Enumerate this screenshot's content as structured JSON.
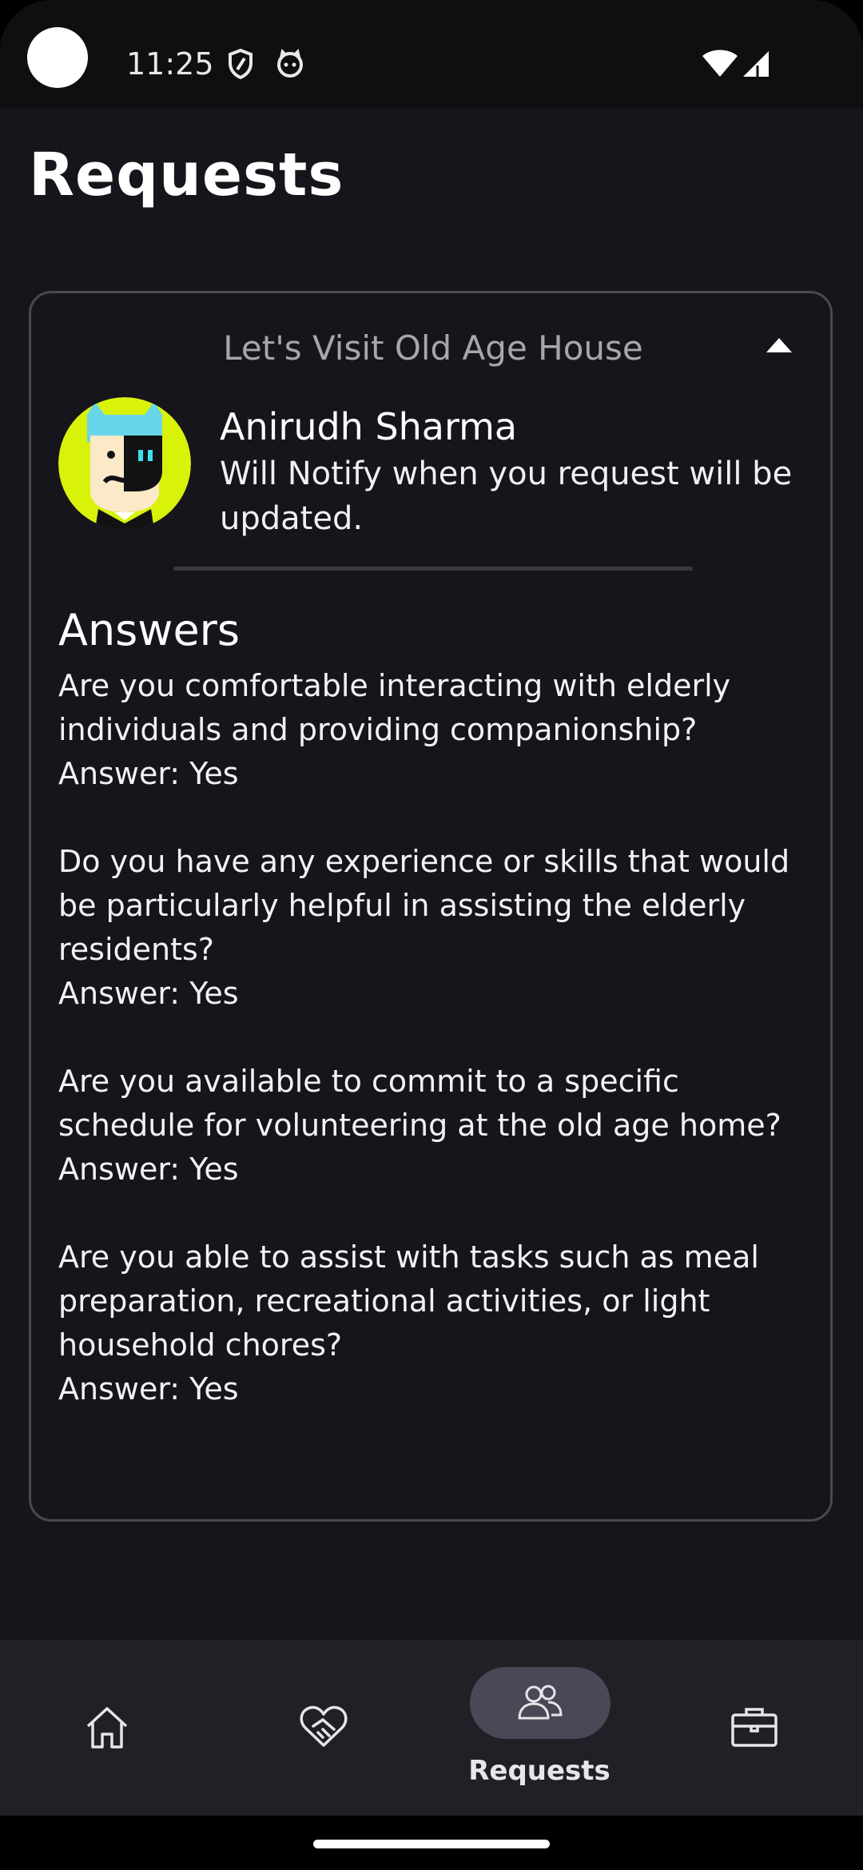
{
  "status_bar": {
    "time": "11:25",
    "icons": [
      "shield-icon",
      "cat-icon",
      "wifi-icon",
      "signal-icon"
    ]
  },
  "page": {
    "title": "Requests"
  },
  "request_card": {
    "title": "Let's Visit Old Age House",
    "expanded": true,
    "user": {
      "name": "Anirudh Sharma",
      "note": "Will Notify when you request will be updated."
    },
    "answers_heading": "Answers",
    "qa": [
      {
        "question": "Are you comfortable interacting with elderly individuals and providing companionship?",
        "answer": "Answer: Yes"
      },
      {
        "question": "Do you have any experience or skills that would be particularly helpful in assisting the elderly residents?",
        "answer": "Answer: Yes"
      },
      {
        "question": "Are you available to commit to a specific schedule for volunteering at the old age home?",
        "answer": "Answer: Yes"
      },
      {
        "question": "Are you able to assist with tasks such as meal preparation, recreational activities, or light household chores?",
        "answer": "Answer: Yes"
      }
    ]
  },
  "bottom_nav": {
    "items": [
      {
        "icon": "home-icon"
      },
      {
        "icon": "heart-handshake-icon"
      },
      {
        "icon": "people-icon",
        "label": "Requests",
        "active": true
      },
      {
        "icon": "briefcase-icon"
      }
    ]
  },
  "colors": {
    "background": "#16151b",
    "status_bar": "#0f0f12",
    "nav_background": "#202026",
    "active_pill": "#4a4856",
    "avatar_bg": "#d9f20a"
  }
}
